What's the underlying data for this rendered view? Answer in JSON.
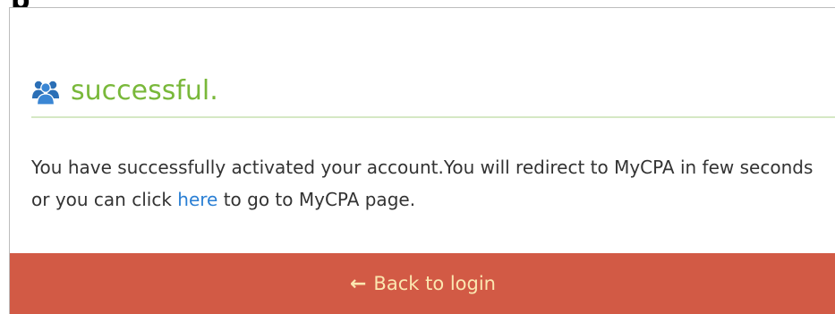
{
  "header": {
    "icon": "users-icon",
    "title": "successful."
  },
  "message": {
    "text_before": "You have successfully activated your account.You will redirect to MyCPA in few seconds or you can click ",
    "link_text": "here",
    "text_after": " to go to MyCPA page."
  },
  "footer": {
    "back_icon": "arrow-left-icon",
    "back_label": "Back to login"
  },
  "colors": {
    "title": "#79b83a",
    "link": "#2a7fd4",
    "footer_bg": "#d25a45",
    "footer_text": "#fbe7b0"
  }
}
